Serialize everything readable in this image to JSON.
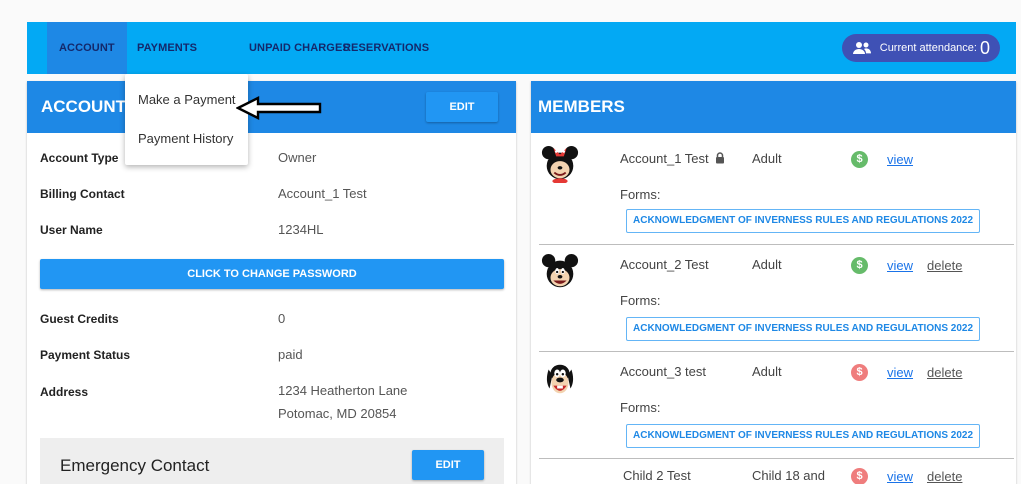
{
  "nav": {
    "tabs": [
      {
        "label": "ACCOUNT"
      },
      {
        "label": "PAYMENTS"
      },
      {
        "label": "UNPAID CHARGES"
      },
      {
        "label": "RESERVATIONS"
      }
    ],
    "attendance_label": "Current attendance:",
    "attendance_value": "0",
    "attendance_icon": "people-icon"
  },
  "payments_menu": {
    "items": [
      {
        "label": "Make a Payment"
      },
      {
        "label": "Payment History"
      }
    ]
  },
  "account": {
    "title": "ACCOUNT",
    "edit_label": "EDIT",
    "fields": [
      {
        "label": "Account Type",
        "value": "Owner"
      },
      {
        "label": "Billing Contact",
        "value": "Account_1 Test"
      },
      {
        "label": "User Name",
        "value": "1234HL"
      },
      {
        "label": "Guest Credits",
        "value": "0"
      },
      {
        "label": "Payment Status",
        "value": "paid"
      },
      {
        "label": "Address",
        "value": "1234 Heatherton Lane",
        "value2": "Potomac, MD 20854"
      }
    ],
    "change_password_label": "CLICK TO CHANGE PASSWORD",
    "emergency": {
      "title": "Emergency Contact",
      "edit_label": "EDIT"
    }
  },
  "members": {
    "title": "MEMBERS",
    "forms_label": "Forms:",
    "list": [
      {
        "name": "Account_1 Test",
        "type": "Adult",
        "dollar_color": "#66bb6a",
        "view": "view",
        "delete": "",
        "form": "ACKNOWLEDGMENT OF INVERNESS RULES AND REGULATIONS 2022",
        "avatar": "minnie-avatar",
        "locked": true
      },
      {
        "name": "Account_2 Test",
        "type": "Adult",
        "dollar_color": "#66bb6a",
        "view": "view",
        "delete": "delete",
        "form": "ACKNOWLEDGMENT OF INVERNESS RULES AND REGULATIONS 2022",
        "avatar": "mickey-avatar",
        "locked": false
      },
      {
        "name": "Account_3 test",
        "type": "Adult",
        "dollar_color": "#ef7d7d",
        "view": "view",
        "delete": "delete",
        "form": "ACKNOWLEDGMENT OF INVERNESS RULES AND REGULATIONS 2022",
        "avatar": "goofy-avatar",
        "locked": false
      },
      {
        "name": "Child 2 Test",
        "type": "Child 18 and",
        "dollar_color": "#ef7d7d",
        "view": "view",
        "delete": "delete",
        "form": "",
        "avatar": "",
        "locked": false
      }
    ]
  },
  "colors": {
    "nav_bg": "#03a9f4",
    "header_bg": "#1e88e5",
    "button_bg": "#2196f3",
    "attendance_bg": "#3f51b5"
  }
}
